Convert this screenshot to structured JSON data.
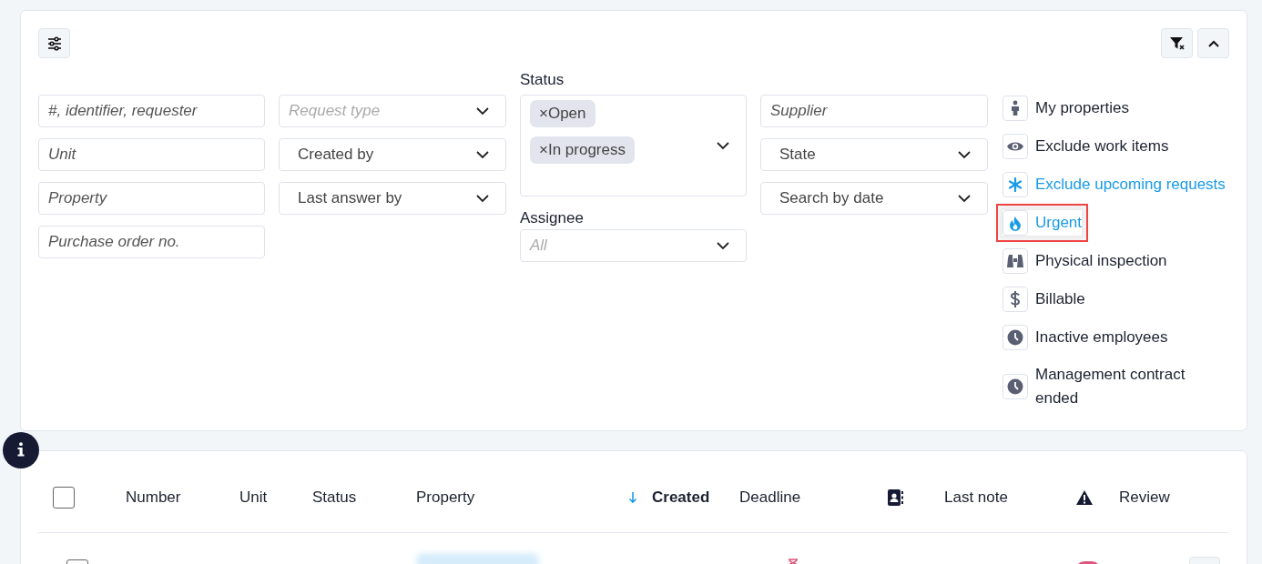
{
  "filters": {
    "text_fields": [
      {
        "placeholder": "#, identifier, requester"
      },
      {
        "placeholder": "Unit"
      },
      {
        "placeholder": "Property"
      },
      {
        "placeholder": "Purchase order no."
      }
    ],
    "selects": [
      {
        "placeholder": "Request type"
      },
      {
        "value": "Created by"
      },
      {
        "value": "Last answer by"
      }
    ],
    "status": {
      "label": "Status",
      "tags": [
        "×Open",
        "×In progress"
      ]
    },
    "assignee": {
      "label": "Assignee",
      "placeholder": "All"
    },
    "column_4": [
      {
        "kind": "input",
        "placeholder": "Supplier"
      },
      {
        "kind": "select",
        "value": "State"
      },
      {
        "kind": "select",
        "value": "Search by date"
      }
    ],
    "toggles": [
      {
        "kind": "person",
        "label": "My properties",
        "active": false,
        "highlighted": false
      },
      {
        "kind": "eye",
        "label": "Exclude work items",
        "active": false,
        "highlighted": false
      },
      {
        "kind": "asterisk",
        "label": "Exclude upcoming requests",
        "active": true,
        "highlighted": false
      },
      {
        "kind": "flame",
        "label": "Urgent",
        "active": true,
        "highlighted": true
      },
      {
        "kind": "binoculars",
        "label": "Physical inspection",
        "active": false,
        "highlighted": false
      },
      {
        "kind": "dollar",
        "label": "Billable",
        "active": false,
        "highlighted": false
      },
      {
        "kind": "clock",
        "label": "Inactive employees",
        "active": false,
        "highlighted": false
      },
      {
        "kind": "clock",
        "label": "Management contract ended",
        "active": false,
        "highlighted": false
      }
    ]
  },
  "table": {
    "all_checked": false,
    "columns": [
      {
        "kind": "text",
        "label": "Number",
        "sorted": false
      },
      {
        "kind": "text",
        "label": "Unit",
        "sorted": false
      },
      {
        "kind": "text",
        "label": "Status",
        "sorted": false
      },
      {
        "kind": "text",
        "label": "Property",
        "sorted": false
      },
      {
        "kind": "text",
        "label": "Created",
        "sorted": true
      },
      {
        "kind": "text",
        "label": "Deadline",
        "sorted": false
      },
      {
        "kind": "contact_icon"
      },
      {
        "kind": "text",
        "label": "Last note",
        "sorted": false
      },
      {
        "kind": "warning_icon"
      },
      {
        "kind": "text",
        "label": "Review",
        "sorted": false
      }
    ],
    "rows": [
      {
        "checked": false
      }
    ]
  }
}
